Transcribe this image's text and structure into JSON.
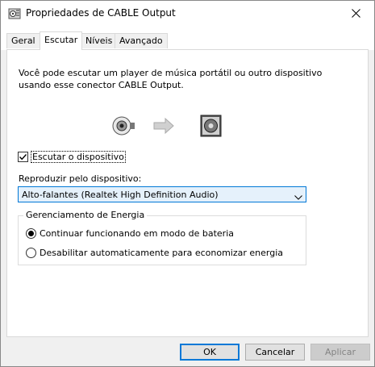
{
  "window": {
    "title": "Propriedades de CABLE Output"
  },
  "tabs": [
    {
      "label": "Geral"
    },
    {
      "label": "Escutar"
    },
    {
      "label": "Níveis"
    },
    {
      "label": "Avançado"
    }
  ],
  "active_tab": "Escutar",
  "listen": {
    "description": "Você pode escutar um player de música portátil ou outro dispositivo usando esse conector CABLE Output.",
    "checkbox_label": "Escutar o dispositivo",
    "checkbox_checked": true,
    "playback_label": "Reproduzir pelo dispositivo:",
    "playback_device": "Alto-falantes (Realtek High Definition Audio)"
  },
  "power": {
    "legend": "Gerenciamento de Energia",
    "options": [
      {
        "label": "Continuar funcionando em modo de bateria",
        "selected": true
      },
      {
        "label": "Desabilitar automaticamente para economizar energia",
        "selected": false
      }
    ]
  },
  "buttons": {
    "ok": "OK",
    "cancel": "Cancelar",
    "apply": "Aplicar"
  },
  "colors": {
    "accent": "#0078d7",
    "combo_bg": "#e5f1fb"
  },
  "icons": {
    "title": "speaker-properties-icon",
    "close": "close-icon",
    "source": "cable-connector-icon",
    "arrow": "arrow-right-icon",
    "target": "speaker-device-icon",
    "combo": "chevron-down-icon"
  }
}
